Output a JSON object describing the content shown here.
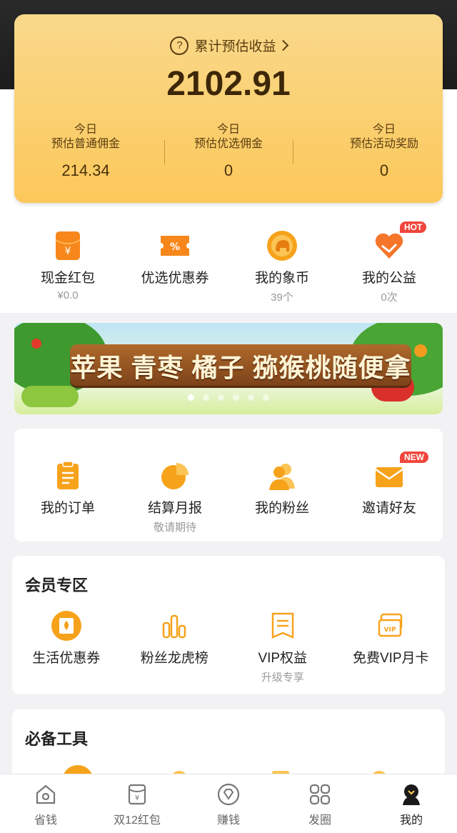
{
  "earnings": {
    "cumulative_label": "累计预估收益",
    "total": "2102.91",
    "columns": [
      {
        "line1": "今日",
        "line2": "预估普通佣金",
        "value": "214.34"
      },
      {
        "line1": "今日",
        "line2": "预估优选佣金",
        "value": "0"
      },
      {
        "line1": "今日",
        "line2": "预估活动奖励",
        "value": "0"
      }
    ]
  },
  "quick": [
    {
      "label": "现金红包",
      "sub": "¥0.0",
      "icon": "red-envelope-icon"
    },
    {
      "label": "优选优惠券",
      "sub": "",
      "icon": "coupon-icon"
    },
    {
      "label": "我的象币",
      "sub": "39个",
      "icon": "elephant-coin-icon"
    },
    {
      "label": "我的公益",
      "sub": "0次",
      "icon": "charity-heart-icon",
      "badge": "HOT"
    }
  ],
  "banner": {
    "slogan": "苹果 青枣 橘子 猕猴桃随便拿",
    "dots": 6,
    "active_dot": 0
  },
  "orders": [
    {
      "label": "我的订单",
      "sub": "",
      "icon": "order-list-icon"
    },
    {
      "label": "结算月报",
      "sub": "敬请期待",
      "icon": "pie-chart-icon"
    },
    {
      "label": "我的粉丝",
      "sub": "",
      "icon": "fans-icon"
    },
    {
      "label": "邀请好友",
      "sub": "",
      "icon": "invite-envelope-icon",
      "badge": "NEW"
    }
  ],
  "member": {
    "title": "会员专区",
    "items": [
      {
        "label": "生活优惠券",
        "sub": "",
        "icon": "life-coupon-icon"
      },
      {
        "label": "粉丝龙虎榜",
        "sub": "",
        "icon": "bar-ranking-icon"
      },
      {
        "label": "VIP权益",
        "sub": "升级专享",
        "icon": "vip-rights-icon"
      },
      {
        "label": "免费VIP月卡",
        "sub": "",
        "icon": "vip-card-icon"
      }
    ]
  },
  "tools": {
    "title": "必备工具"
  },
  "nav": [
    {
      "label": "省钱",
      "icon": "home-save-icon"
    },
    {
      "label": "双12红包",
      "icon": "red-packet-icon"
    },
    {
      "label": "赚钱",
      "icon": "diamond-icon"
    },
    {
      "label": "发圈",
      "icon": "grid-icon"
    },
    {
      "label": "我的",
      "icon": "profile-icon",
      "active": true
    }
  ],
  "colors": {
    "accent": "#fcc85a",
    "icon_orange": "#f7a21b",
    "badge_red": "#f0463c"
  }
}
